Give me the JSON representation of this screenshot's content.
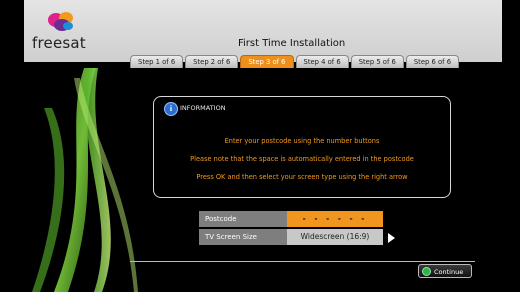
{
  "header": {
    "logo_text": "freesat",
    "title": "First Time Installation"
  },
  "steps": [
    {
      "label": "Step 1 of 6"
    },
    {
      "label": "Step 2 of 6"
    },
    {
      "label": "Step 3 of 6"
    },
    {
      "label": "Step 4 of 6"
    },
    {
      "label": "Step 5 of 6"
    },
    {
      "label": "Step 6 of 6"
    }
  ],
  "info": {
    "icon_glyph": "i",
    "title": "INFORMATION",
    "lines": [
      "Enter your postcode using the number buttons",
      "Please note that the space is automatically entered in the postcode",
      "Press OK and then select your screen type using the right arrow"
    ]
  },
  "form": {
    "postcode_label": "Postcode",
    "postcode_value": "- - - - - -",
    "screen_label": "TV Screen Size",
    "screen_value": "Widescreen (16:9)"
  },
  "footer": {
    "continue_label": "Continue"
  },
  "colors": {
    "accent_orange": "#f0961f",
    "info_text": "#f39a1c",
    "continue_icon": "#2db34a",
    "info_icon": "#2a6fd0"
  },
  "active_step_index": 2
}
